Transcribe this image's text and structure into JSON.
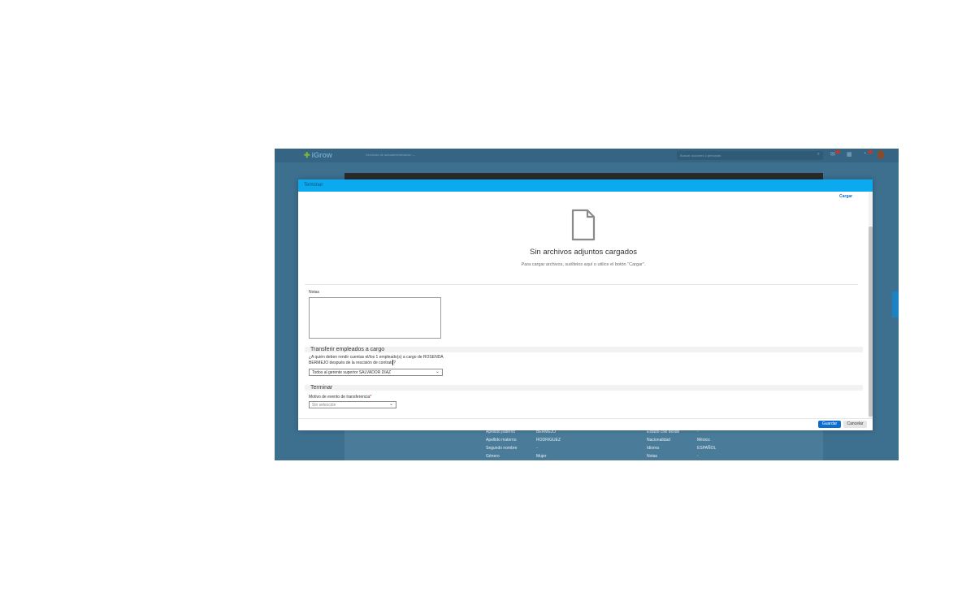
{
  "app": {
    "logo": "iGrow",
    "menu": "Servicios de autoadministración ⌄",
    "search_placeholder": "Buscar acciones o personas",
    "badge_count_1": "24",
    "badge_count_2": "24",
    "profile_rows": [
      {
        "k1": "Apellido paterno",
        "v1": "BERMEJO",
        "k2": "Estado civil desde",
        "v2": "-"
      },
      {
        "k1": "Apellido materno",
        "v1": "RODRIGUEZ",
        "k2": "Nacionalidad",
        "v2": "México"
      },
      {
        "k1": "Segundo nombre",
        "v1": "-",
        "k2": "Idioma",
        "v2": "ESPAÑOL"
      },
      {
        "k1": "Género",
        "v1": "Mujer",
        "k2": "Notas",
        "v2": "-"
      }
    ]
  },
  "dialog": {
    "title": "Terminar",
    "upload_link": "Cargar",
    "empty_title": "Sin archivos adjuntos cargados",
    "empty_subtitle": "Para cargar archivos, suéltelos aquí o utilice el botón \"Cargar\".",
    "notes_label": "Notas",
    "notes_value": "",
    "transfer": {
      "title": "Transferir empleados a cargo",
      "question": "¿A quién deben rendir cuentas el/los 1 empleado(s) a cargo de ROSENDA BERMEJO después de la rescisión de contrato?",
      "selected": "Todos al gerente superior SALVADOR DIAZ"
    },
    "terminate": {
      "title": "Terminar",
      "reason_label": "Motivo de evento de transferencia",
      "required_mark": "*",
      "reason_placeholder": "Sin selección"
    },
    "buttons": {
      "save": "Guardar",
      "cancel": "Cancelar"
    }
  },
  "colors": {
    "header": "#0aa9f0",
    "primary_button": "#0a6ed1",
    "overlay": "#3d6f8f"
  },
  "icons": {
    "file": "document-icon",
    "chevron": "chevron-down-icon"
  }
}
